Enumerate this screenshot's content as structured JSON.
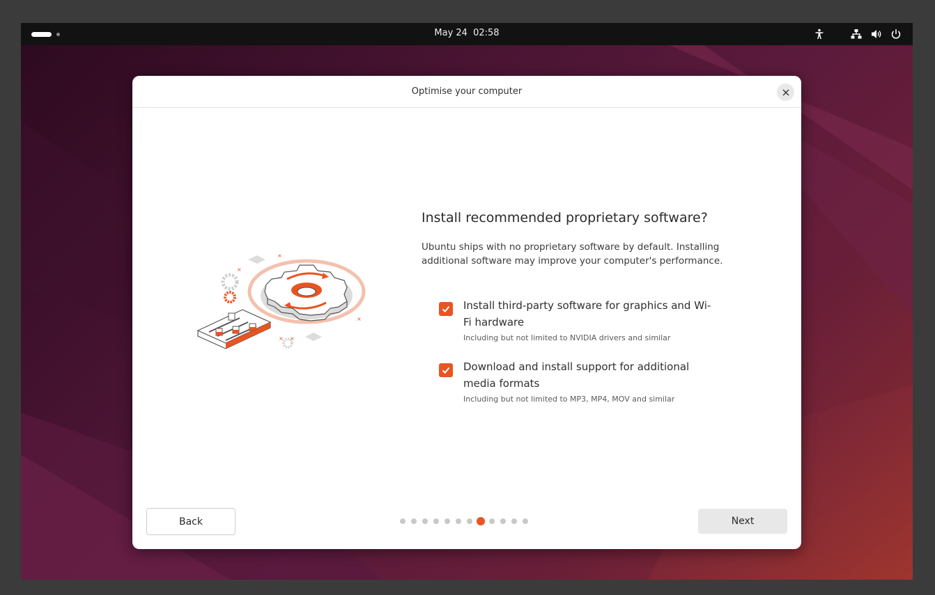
{
  "topbar": {
    "date": "May 24",
    "time": "02:58",
    "icons": [
      "accessibility-icon",
      "network-icon",
      "volume-icon",
      "power-icon"
    ]
  },
  "dialog": {
    "title": "Optimise your computer",
    "heading": "Install recommended proprietary software?",
    "description": "Ubuntu ships with no proprietary software by default. Installing additional software may improve your computer's performance.",
    "options": [
      {
        "label": "Install third-party software for graphics and Wi-Fi hardware",
        "sublabel": "Including but not limited to NVIDIA drivers and similar",
        "checked": true
      },
      {
        "label": "Download and install support for additional media formats",
        "sublabel": "Including but not limited to MP3, MP4, MOV and similar",
        "checked": true
      }
    ],
    "back_label": "Back",
    "next_label": "Next",
    "progress": {
      "total_steps": 12,
      "current_step": 8
    }
  },
  "colors": {
    "accent": "#e95420",
    "topbar": "#121212",
    "dialog_bg": "#ffffff"
  }
}
